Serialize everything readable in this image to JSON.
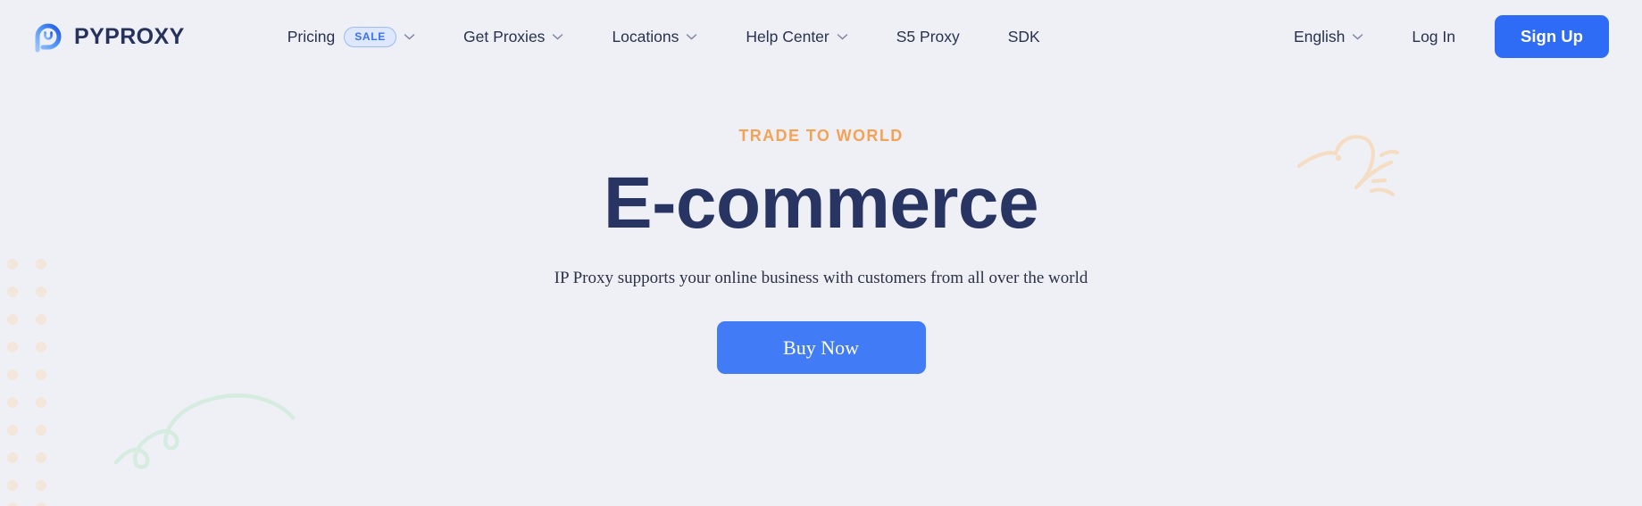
{
  "theme": {
    "page_background": "#eff0f5",
    "brand_navy": "#26325c",
    "accent_blue": "#2f6cf6",
    "accent_orange": "#f4a356",
    "badge_blue_bg": "#dde7fd",
    "badge_blue_text": "#3b6ff5",
    "decor_green": "#d6ece0",
    "decor_peach": "#f5ddc4"
  },
  "header": {
    "logo_icon": "pyproxy-circle-logo-icon",
    "brand_name": "PYPROXY",
    "nav": [
      {
        "label": "Pricing",
        "badge": "SALE",
        "caret": true
      },
      {
        "label": "Get Proxies",
        "badge": null,
        "caret": true
      },
      {
        "label": "Locations",
        "badge": null,
        "caret": true
      },
      {
        "label": "Help Center",
        "badge": null,
        "caret": true
      },
      {
        "label": "S5 Proxy",
        "badge": null,
        "caret": false
      },
      {
        "label": "SDK",
        "badge": null,
        "caret": false
      }
    ],
    "language": {
      "label": "English",
      "caret": true
    },
    "login_label": "Log In",
    "signup_label": "Sign Up"
  },
  "hero": {
    "eyebrow": "TRADE TO WORLD",
    "headline": "E-commerce",
    "subheadline": "IP Proxy supports your online business with customers from all over the world",
    "cta_label": "Buy Now"
  },
  "decorations": {
    "dots_icon": "dot-grid-icon",
    "green_squiggle_icon": "curly-line-icon",
    "peach_squiggle_icon": "bird-doodle-icon"
  }
}
